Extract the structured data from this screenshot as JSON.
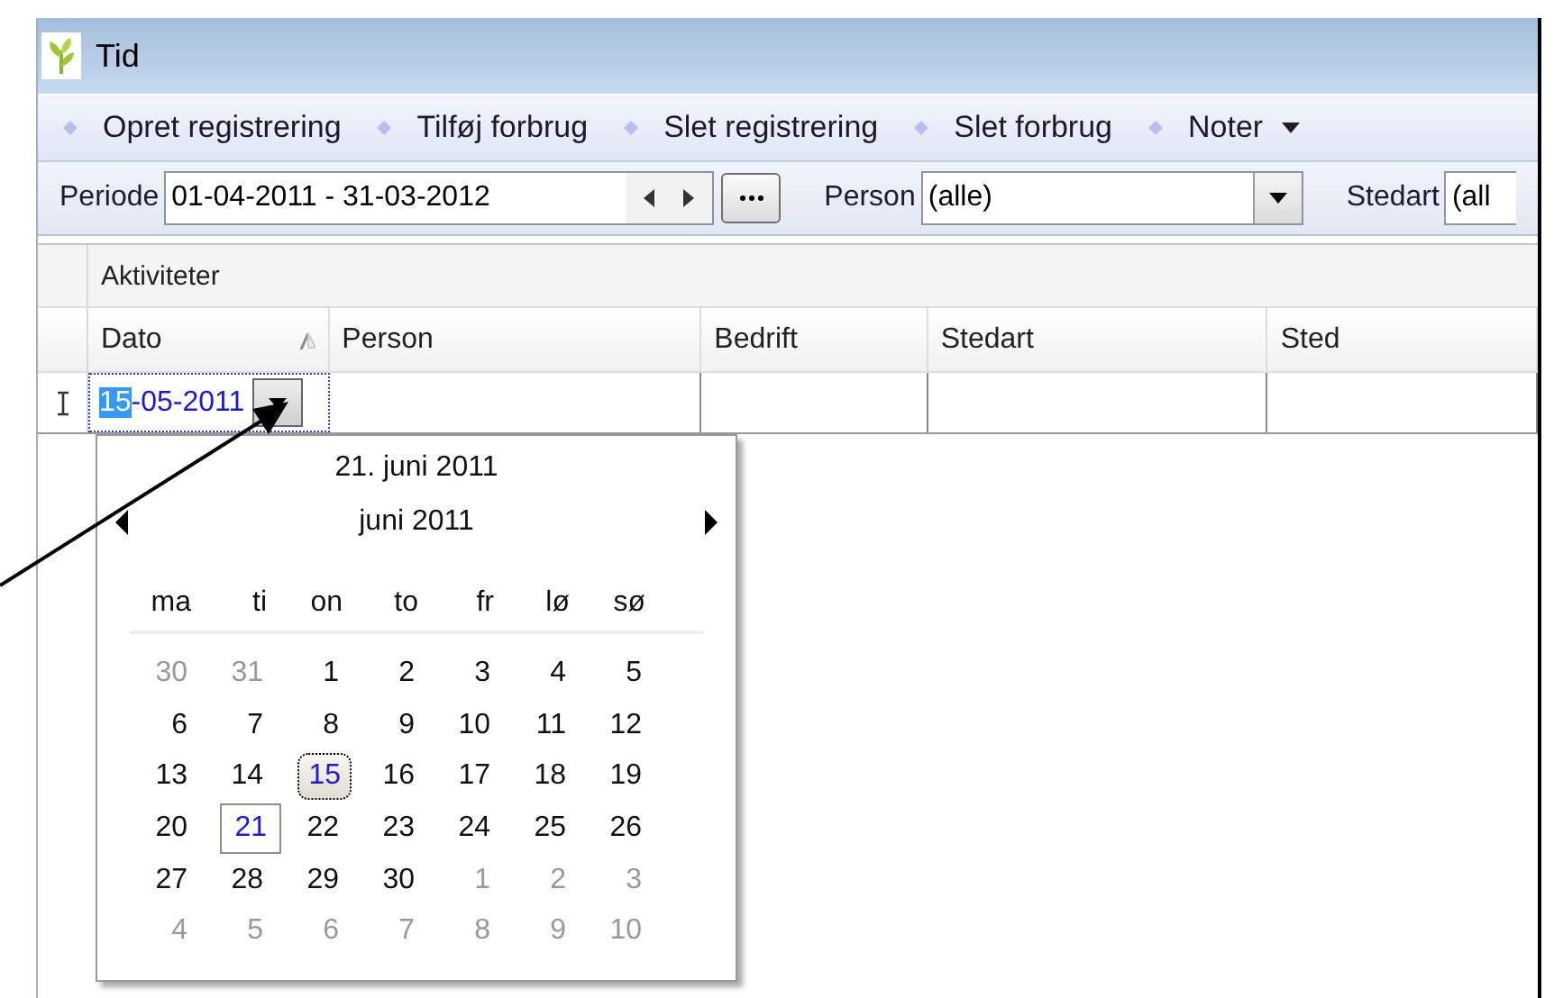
{
  "window": {
    "title": "Tid"
  },
  "toolbar": [
    {
      "label": "Opret registrering",
      "dropdown": false
    },
    {
      "label": "Tilføj forbrug",
      "dropdown": false
    },
    {
      "label": "Slet registrering",
      "dropdown": false
    },
    {
      "label": "Slet forbrug",
      "dropdown": false
    },
    {
      "label": "Noter",
      "dropdown": true
    }
  ],
  "filters": {
    "period": {
      "label": "Periode",
      "value": "01-04-2011 - 31-03-2012"
    },
    "person": {
      "label": "Person",
      "value": "(alle)"
    },
    "stedart": {
      "label": "Stedart",
      "value": "(all"
    }
  },
  "grid": {
    "group": "Aktiviteter",
    "columns": [
      {
        "label": "Dato",
        "sorted": true
      },
      {
        "label": "Person",
        "sorted": false
      },
      {
        "label": "Bedrift",
        "sorted": false
      },
      {
        "label": "Stedart",
        "sorted": false
      },
      {
        "label": "Sted",
        "sorted": false
      }
    ],
    "edit_row": {
      "date_selected": "15",
      "date_rest": "-05-2011"
    }
  },
  "calendar": {
    "today_label": "21. juni 2011",
    "month": "juni 2011",
    "weekdays": [
      "ma",
      "ti",
      "on",
      "to",
      "fr",
      "lø",
      "sø"
    ],
    "weeks": [
      [
        {
          "day": "30",
          "other_month": true,
          "selected": false,
          "today": false
        },
        {
          "day": "31",
          "other_month": true,
          "selected": false,
          "today": false
        },
        {
          "day": "1",
          "other_month": false,
          "selected": false,
          "today": false
        },
        {
          "day": "2",
          "other_month": false,
          "selected": false,
          "today": false
        },
        {
          "day": "3",
          "other_month": false,
          "selected": false,
          "today": false
        },
        {
          "day": "4",
          "other_month": false,
          "selected": false,
          "today": false
        },
        {
          "day": "5",
          "other_month": false,
          "selected": false,
          "today": false
        }
      ],
      [
        {
          "day": "6",
          "other_month": false,
          "selected": false,
          "today": false
        },
        {
          "day": "7",
          "other_month": false,
          "selected": false,
          "today": false
        },
        {
          "day": "8",
          "other_month": false,
          "selected": false,
          "today": false
        },
        {
          "day": "9",
          "other_month": false,
          "selected": false,
          "today": false
        },
        {
          "day": "10",
          "other_month": false,
          "selected": false,
          "today": false
        },
        {
          "day": "11",
          "other_month": false,
          "selected": false,
          "today": false
        },
        {
          "day": "12",
          "other_month": false,
          "selected": false,
          "today": false
        }
      ],
      [
        {
          "day": "13",
          "other_month": false,
          "selected": false,
          "today": false
        },
        {
          "day": "14",
          "other_month": false,
          "selected": false,
          "today": false
        },
        {
          "day": "15",
          "other_month": false,
          "selected": true,
          "today": false
        },
        {
          "day": "16",
          "other_month": false,
          "selected": false,
          "today": false
        },
        {
          "day": "17",
          "other_month": false,
          "selected": false,
          "today": false
        },
        {
          "day": "18",
          "other_month": false,
          "selected": false,
          "today": false
        },
        {
          "day": "19",
          "other_month": false,
          "selected": false,
          "today": false
        }
      ],
      [
        {
          "day": "20",
          "other_month": false,
          "selected": false,
          "today": false
        },
        {
          "day": "21",
          "other_month": false,
          "selected": false,
          "today": true
        },
        {
          "day": "22",
          "other_month": false,
          "selected": false,
          "today": false
        },
        {
          "day": "23",
          "other_month": false,
          "selected": false,
          "today": false
        },
        {
          "day": "24",
          "other_month": false,
          "selected": false,
          "today": false
        },
        {
          "day": "25",
          "other_month": false,
          "selected": false,
          "today": false
        },
        {
          "day": "26",
          "other_month": false,
          "selected": false,
          "today": false
        }
      ],
      [
        {
          "day": "27",
          "other_month": false,
          "selected": false,
          "today": false
        },
        {
          "day": "28",
          "other_month": false,
          "selected": false,
          "today": false
        },
        {
          "day": "29",
          "other_month": false,
          "selected": false,
          "today": false
        },
        {
          "day": "30",
          "other_month": false,
          "selected": false,
          "today": false
        },
        {
          "day": "1",
          "other_month": true,
          "selected": false,
          "today": false
        },
        {
          "day": "2",
          "other_month": true,
          "selected": false,
          "today": false
        },
        {
          "day": "3",
          "other_month": true,
          "selected": false,
          "today": false
        }
      ],
      [
        {
          "day": "4",
          "other_month": true,
          "selected": false,
          "today": false
        },
        {
          "day": "5",
          "other_month": true,
          "selected": false,
          "today": false
        },
        {
          "day": "6",
          "other_month": true,
          "selected": false,
          "today": false
        },
        {
          "day": "7",
          "other_month": true,
          "selected": false,
          "today": false
        },
        {
          "day": "8",
          "other_month": true,
          "selected": false,
          "today": false
        },
        {
          "day": "9",
          "other_month": true,
          "selected": false,
          "today": false
        },
        {
          "day": "10",
          "other_month": true,
          "selected": false,
          "today": false
        }
      ]
    ]
  }
}
